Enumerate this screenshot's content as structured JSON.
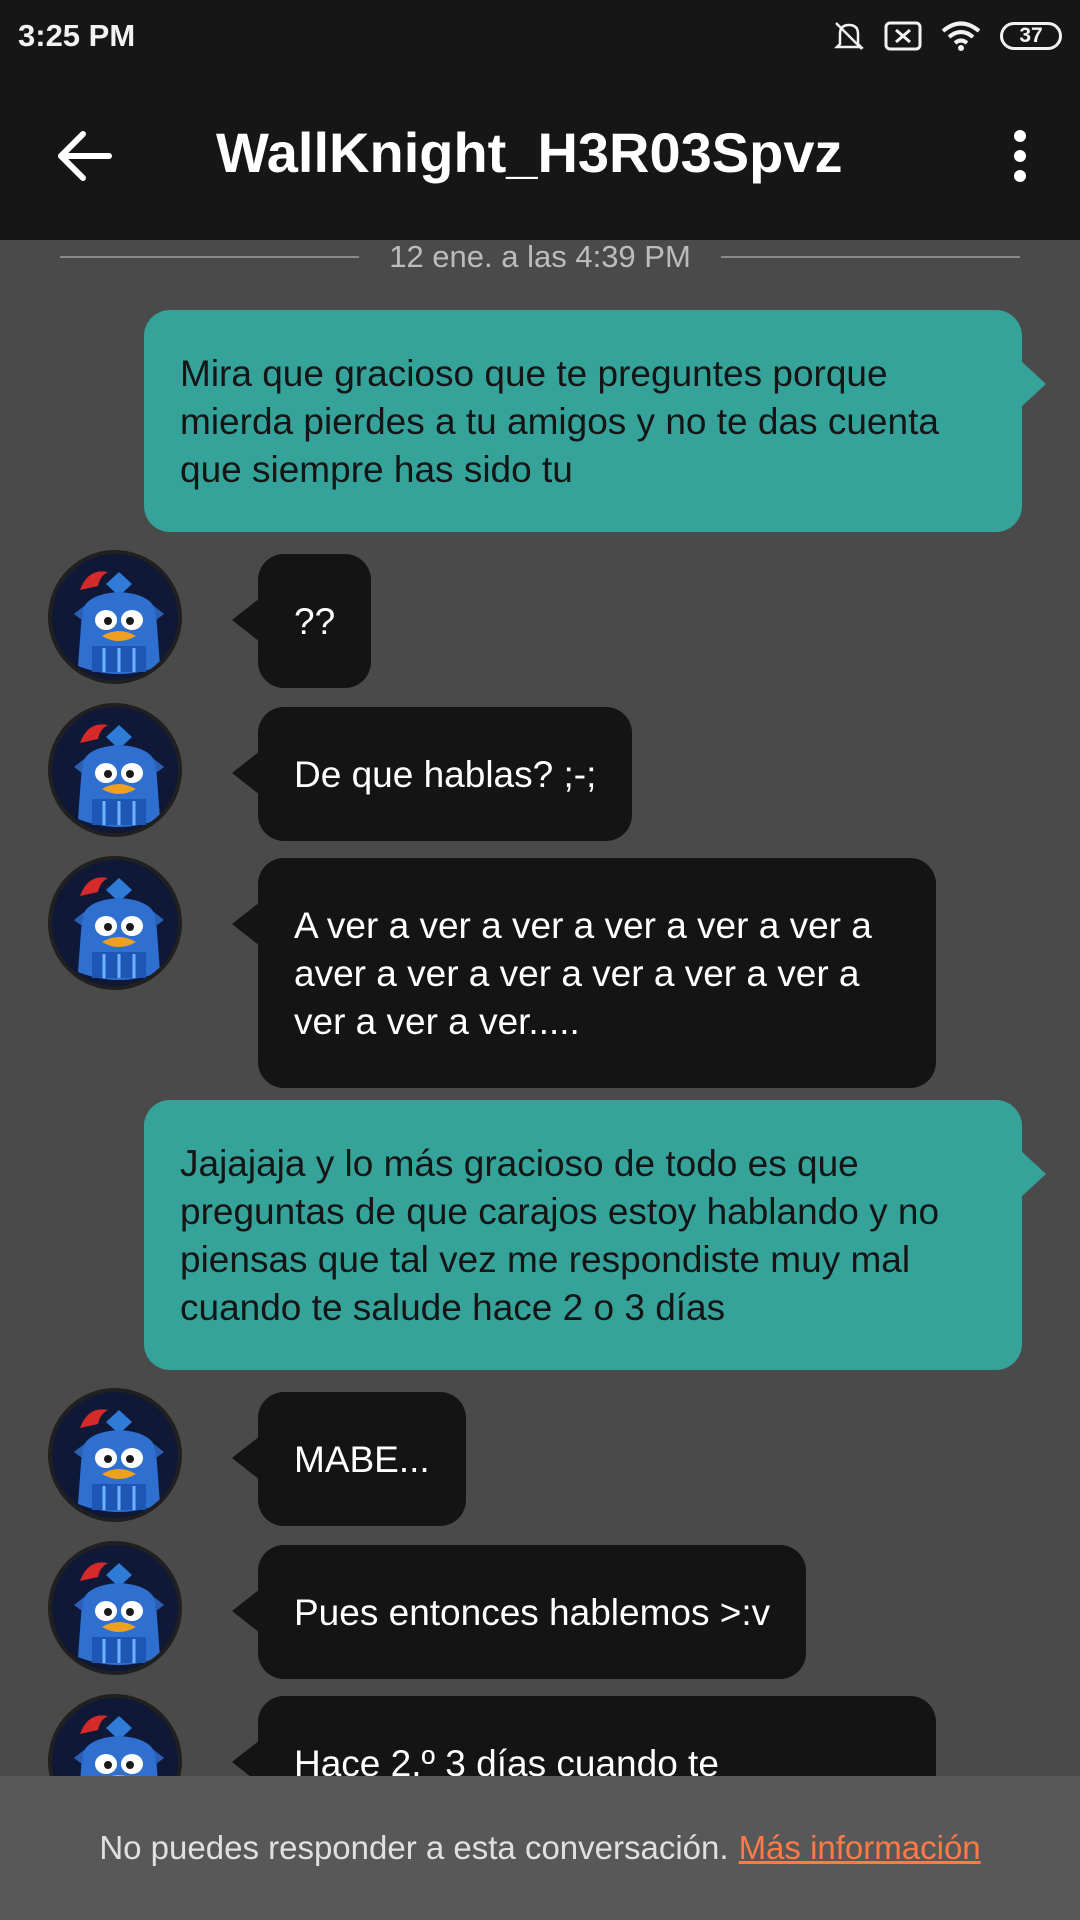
{
  "status_bar": {
    "time": "3:25 PM",
    "battery": "37"
  },
  "header": {
    "title": "WallKnight_H3R03Spvz"
  },
  "date_separator": "12 ene. a las 4:39 PM",
  "messages": [
    {
      "direction": "out",
      "text": "Mira que gracioso que te preguntes porque mierda pierdes a tu amigos y no te das cuenta que siempre has sido tu"
    },
    {
      "direction": "in",
      "text": "??"
    },
    {
      "direction": "in",
      "text": "De que hablas? ;-;"
    },
    {
      "direction": "in",
      "text": "A ver a ver a ver a ver a ver a ver a aver a ver a ver a ver a ver a ver a ver a ver a ver....."
    },
    {
      "direction": "out",
      "text": "Jajajaja y lo más gracioso de todo es que preguntas de que carajos estoy hablando y no piensas que tal vez me respondiste muy mal cuando te salude hace 2 o 3 días"
    },
    {
      "direction": "in",
      "text": "MABE..."
    },
    {
      "direction": "in",
      "text": "Pues entonces hablemos >:v"
    },
    {
      "direction": "in",
      "text": "Hace 2.º 3 días cuando te"
    }
  ],
  "footer": {
    "notice": "No puedes responder a esta conversación.",
    "link": "Más información"
  },
  "colors": {
    "outgoing_bubble": "#35a39a",
    "incoming_bubble": "#141414",
    "background": "#4a4a4a",
    "link": "#ff7a45"
  }
}
